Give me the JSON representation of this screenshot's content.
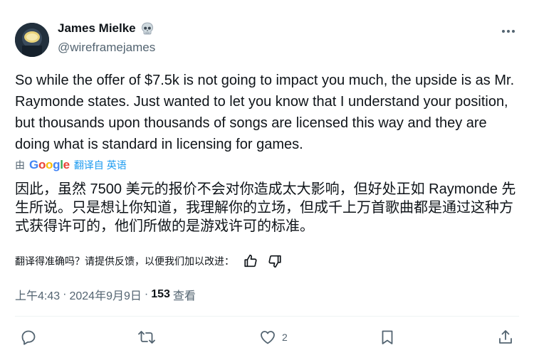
{
  "author": {
    "name": "James Mielke",
    "handle": "@wireframejames",
    "badge_icon": "skull-icon"
  },
  "tweet": {
    "text": "So while the offer of $7.5k is not going to impact you much, the upside is as Mr. Raymonde states. Just wanted to let you know that I understand your position, but thousands upon thousands of songs are licensed this way and they are doing what is standard in licensing for games."
  },
  "translation": {
    "by_label": "由",
    "provider": {
      "G": "G",
      "o1": "o",
      "o2": "o",
      "g": "g",
      "l": "l",
      "e": "e"
    },
    "translated_from_label": "翻译自 英语",
    "text": "因此，虽然 7500 美元的报价不会对你造成太大影响，但好处正如 Raymonde 先生所说。只是想让你知道，我理解你的立场，但成千上万首歌曲都是通过这种方式获得许可的，他们所做的是游戏许可的标准。",
    "feedback_prompt": "翻译得准确吗？请提供反馈，以便我们加以改进："
  },
  "meta": {
    "time": "上午4:43",
    "separator": "·",
    "date": "2024年9月9日",
    "views_count": "153",
    "views_label": "查看"
  },
  "actions": {
    "reply_count": "",
    "retweet_count": "",
    "like_count": "2"
  },
  "colors": {
    "text": "#0f1419",
    "secondary": "#536471",
    "link": "#1d9bf0"
  }
}
